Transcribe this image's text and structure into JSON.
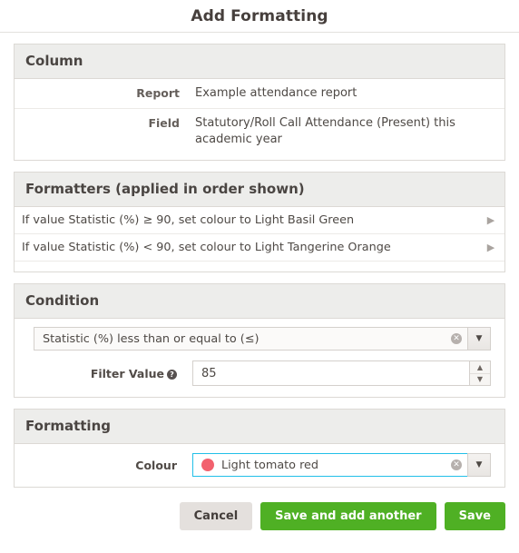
{
  "dialog": {
    "title": "Add Formatting"
  },
  "column_section": {
    "header": "Column",
    "rows": [
      {
        "label": "Report",
        "value": "Example attendance report"
      },
      {
        "label": "Field",
        "value": "Statutory/Roll Call Attendance (Present) this academic year"
      }
    ]
  },
  "formatters_section": {
    "header": "Formatters (applied in order shown)",
    "rows": [
      {
        "text": "If value Statistic (%) ≥ 90, set colour to Light Basil Green",
        "arrow": "▶"
      },
      {
        "text": "If value Statistic (%) < 90, set colour to Light Tangerine Orange",
        "arrow": "▶"
      }
    ]
  },
  "condition_section": {
    "header": "Condition",
    "operator": {
      "value": "Statistic (%) less than or equal to (≤)",
      "clear_icon": "✕",
      "dropdown_icon": "▼"
    },
    "filter_value": {
      "label": "Filter Value",
      "help_icon": "?",
      "value": "85",
      "spin_up_icon": "▲",
      "spin_down_icon": "▼"
    }
  },
  "formatting_section": {
    "header": "Formatting",
    "colour": {
      "label": "Colour",
      "value": "Light tomato red",
      "swatch_hex": "#f2616e",
      "clear_icon": "✕",
      "dropdown_icon": "▼",
      "focus_hex": "#22c0e8"
    }
  },
  "footer": {
    "cancel_label": "Cancel",
    "save_and_add_label": "Save and add another",
    "save_label": "Save",
    "green_hex": "#4fb024"
  }
}
